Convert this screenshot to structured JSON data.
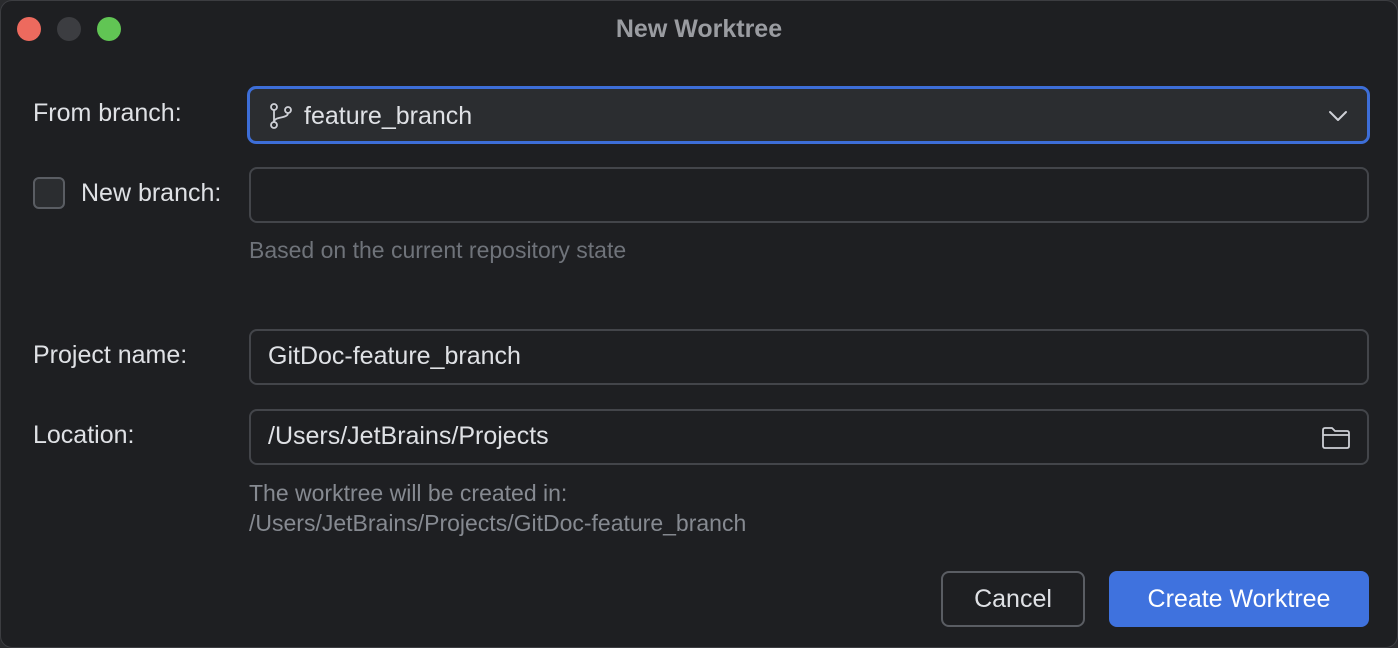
{
  "window": {
    "title": "New Worktree"
  },
  "form": {
    "from_branch": {
      "label": "From branch:",
      "value": "feature_branch",
      "icon": "git-branch-icon"
    },
    "new_branch": {
      "label": "New branch:",
      "checked": false,
      "value": "",
      "hint": "Based on the current repository state"
    },
    "project_name": {
      "label": "Project name:",
      "value": "GitDoc-feature_branch"
    },
    "location": {
      "label": "Location:",
      "value": "/Users/JetBrains/Projects",
      "icon": "folder-icon",
      "hint_line1": "The worktree will be created in:",
      "hint_line2": "/Users/JetBrains/Projects/GitDoc-feature_branch"
    }
  },
  "buttons": {
    "cancel": "Cancel",
    "create": "Create Worktree"
  },
  "colors": {
    "accent": "#3f72de",
    "background": "#1e1f22",
    "close": "#ed6a5e",
    "maximize": "#61c554"
  }
}
